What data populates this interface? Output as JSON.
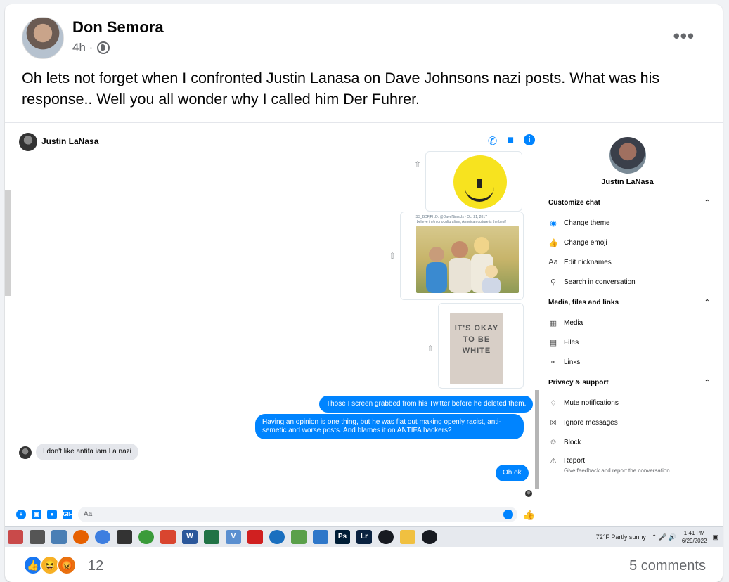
{
  "post": {
    "author": "Don Semora",
    "time": "4h ·",
    "text": "Oh lets not forget when I confronted Justin Lanasa on Dave Johnsons nazi posts. What was his response.. Well you all wonder why I called him Der Fuhrer.",
    "reaction_count": "12",
    "comments": "5 comments",
    "reactions": [
      "like-icon",
      "haha-icon",
      "angry-icon"
    ]
  },
  "screenshot": {
    "chat": {
      "contact": "Justin LaNasa",
      "tweet1_meta": "ISS_BDF,Ph.D. @DaveNimsUs · Oct 21, 2017",
      "tweet1_text": "I believe in #monoculturalism, American culture is the best!",
      "poster_text": "IT'S OKAY TO BE WHITE",
      "messages": [
        {
          "dir": "out",
          "text": "Those I screen grabbed from his Twitter before he deleted them."
        },
        {
          "dir": "out",
          "text": "Having an opinion is one thing, but he was flat out making openly racist, anti-semetic and worse posts. And blames it on ANTIFA hackers?"
        },
        {
          "dir": "in",
          "text": "I don't like antifa iam I a nazi"
        },
        {
          "dir": "out",
          "text": "Oh ok"
        }
      ],
      "composer_placeholder": "Aa"
    },
    "panel": {
      "name": "Justin LaNasa",
      "customize_heading": "Customize chat",
      "change_theme": "Change theme",
      "change_emoji": "Change emoji",
      "edit_nicknames": "Edit nicknames",
      "search": "Search in conversation",
      "media_heading": "Media, files and links",
      "media": "Media",
      "files": "Files",
      "links": "Links",
      "privacy_heading": "Privacy & support",
      "mute": "Mute notifications",
      "ignore": "Ignore messages",
      "block": "Block",
      "report": "Report",
      "report_sub": "Give feedback and report the conversation"
    },
    "taskbar": {
      "weather": "72°F  Partly sunny",
      "time": "1:41 PM",
      "date": "6/29/2022"
    }
  }
}
